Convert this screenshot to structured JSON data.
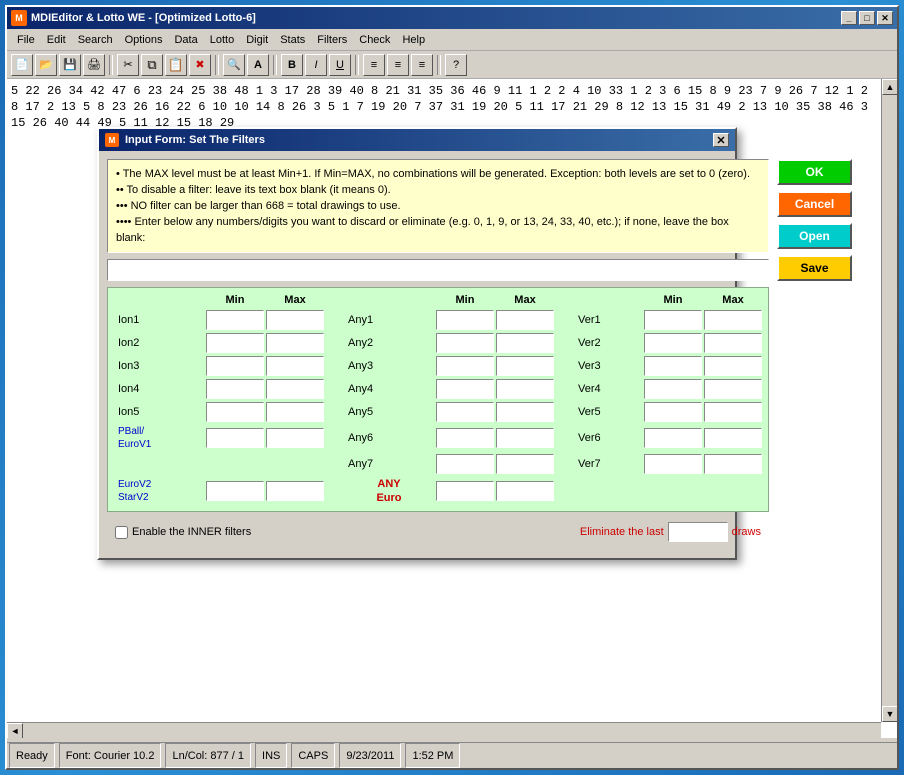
{
  "window": {
    "title": "MDIEditor & Lotto WE - [Optimized Lotto-6]",
    "icon": "M"
  },
  "menubar": {
    "items": [
      {
        "label": "File"
      },
      {
        "label": "Edit"
      },
      {
        "label": "Search"
      },
      {
        "label": "Options"
      },
      {
        "label": "Data"
      },
      {
        "label": "Lotto"
      },
      {
        "label": "Digit"
      },
      {
        "label": "Stats"
      },
      {
        "label": "Filters"
      },
      {
        "label": "Check"
      },
      {
        "label": "Help"
      }
    ]
  },
  "toolbar": {
    "buttons": [
      "📄",
      "📂",
      "💾",
      "🖨",
      "✂",
      "📋",
      "📋",
      "✖",
      "🔍",
      "A",
      "B",
      "I",
      "U",
      "≡",
      "≡",
      "≡",
      "?"
    ]
  },
  "dialog": {
    "title": "Input Form: Set The Filters",
    "close_btn": "✕",
    "info_lines": [
      "• The MAX level must be at least Min+1. If Min=MAX, no combinations will be generated.  Exception: both levels are set to 0 (zero).",
      "•• To disable a filter: leave its text box blank (it means 0).",
      "••• NO filter can be larger than 668 = total drawings to use.",
      "•••• Enter below any numbers/digits you want to discard or eliminate  (e.g.  0, 1, 9, or 13, 24, 33, 40, etc.);  if none, leave the box blank:"
    ],
    "buttons": {
      "ok": "OK",
      "cancel": "Cancel",
      "open": "Open",
      "save": "Save"
    },
    "grid": {
      "col_headers": [
        "Min",
        "Max",
        "Min",
        "Max",
        "Min",
        "Max"
      ],
      "rows": [
        {
          "label": "Ion1",
          "label_class": "normal",
          "min1": "",
          "max1": "",
          "label2": "Any1",
          "min2": "",
          "max2": "",
          "label3": "Ver1",
          "min3": "",
          "max3": ""
        },
        {
          "label": "Ion2",
          "label_class": "normal",
          "min1": "",
          "max1": "",
          "label2": "Any2",
          "min2": "",
          "max2": "",
          "label3": "Ver2",
          "min3": "",
          "max3": ""
        },
        {
          "label": "Ion3",
          "label_class": "normal",
          "min1": "",
          "max1": "",
          "label2": "Any3",
          "min2": "",
          "max2": "",
          "label3": "Ver3",
          "min3": "",
          "max3": ""
        },
        {
          "label": "Ion4",
          "label_class": "normal",
          "min1": "",
          "max1": "",
          "label2": "Any4",
          "min2": "",
          "max2": "",
          "label3": "Ver4",
          "min3": "",
          "max3": ""
        },
        {
          "label": "Ion5",
          "label_class": "normal",
          "min1": "",
          "max1": "",
          "label2": "Any5",
          "min2": "",
          "max2": "",
          "label3": "Ver5",
          "min3": "",
          "max3": ""
        },
        {
          "label": "PBall/\nEuroV1",
          "label_class": "blue",
          "min1": "",
          "max1": "",
          "label2": "Any6",
          "min2": "",
          "max2": "",
          "label3": "Ver6",
          "min3": "",
          "max3": ""
        },
        {
          "label": "",
          "label_class": "normal",
          "min1": "",
          "max1": "",
          "label2": "Any7",
          "min2": "",
          "max2": "",
          "label3": "Ver7",
          "min3": "",
          "max3": ""
        },
        {
          "label": "EuroV2\nStarV2",
          "label_class": "blue",
          "min1": "",
          "max1": "",
          "label2": "ANY\nEuro",
          "label2_class": "red",
          "min2": "",
          "max2": "",
          "label3": "",
          "min3": "",
          "max3": ""
        }
      ]
    },
    "bottom": {
      "checkbox_label": "Enable the INNER filters",
      "checkbox_checked": false,
      "eliminate_label": "Eliminate the last",
      "eliminate_value": "",
      "draws_label": "draws"
    }
  },
  "lotto_bg_numbers": [
    "  5  22  26  34  42  47",
    "  6  23  24  25  38  48",
    "  1   3  17  28  39  40",
    "  8  21  31  35  36  46",
    "  9  11",
    "  1   2",
    "  2   4",
    " 10  33  1  2  3",
    "  6  15",
    "  8   9",
    " 23   7",
    "  9  26",
    "  7  12",
    "  1   2",
    "  8  17",
    "  2  13",
    "  5   8",
    " 23  26",
    " 16  22",
    "  6  10",
    " 10  14",
    "  8  26",
    "  3   5",
    "  1   7",
    " 19  20",
    "  7  37",
    " 31  19  20",
    "  5  11  17  21  29",
    "  8  12  13  15  31  49",
    "  2  13  10  35  38  46",
    "  3  15  26  40  44  49",
    "  5  11  12  15  18  29"
  ],
  "statusbar": {
    "ready": "Ready",
    "font_info": "Font: Courier 10.2",
    "ln_col": "Ln/Col: 877 / 1",
    "ins": "INS",
    "caps": "CAPS",
    "date": "9/23/2011",
    "time": "1:52 PM"
  }
}
